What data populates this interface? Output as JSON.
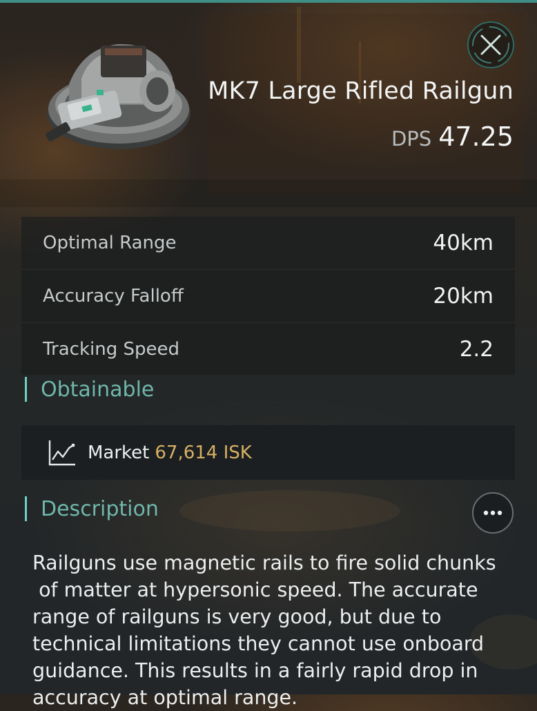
{
  "colors": {
    "accent": "#6fb7ab",
    "accent_bar": "#6fd1c4",
    "price": "#d8b164",
    "panel": "#1b1f21"
  },
  "header": {
    "item_name": "MK7 Large Rifled Railgun",
    "dps_label": "DPS",
    "dps_value": "47.25",
    "close_icon": "close-icon"
  },
  "stats": [
    {
      "label": "Optimal Range",
      "value": "40km"
    },
    {
      "label": "Accuracy Falloff",
      "value": "20km"
    },
    {
      "label": "Tracking Speed",
      "value": "2.2"
    }
  ],
  "obtainable": {
    "title": "Obtainable",
    "market_icon": "market-chart-icon",
    "market_label": "Market",
    "market_price": "67,614 ISK"
  },
  "description": {
    "title": "Description",
    "more_icon": "more-icon",
    "text": "Railguns use magnetic rails to fire solid chunks\n of matter at hypersonic speed. The accurate\nrange of railguns is very good, but due to\ntechnical limitations they cannot use onboard\nguidance. This results in a fairly rapid drop in\naccuracy at optimal range."
  }
}
